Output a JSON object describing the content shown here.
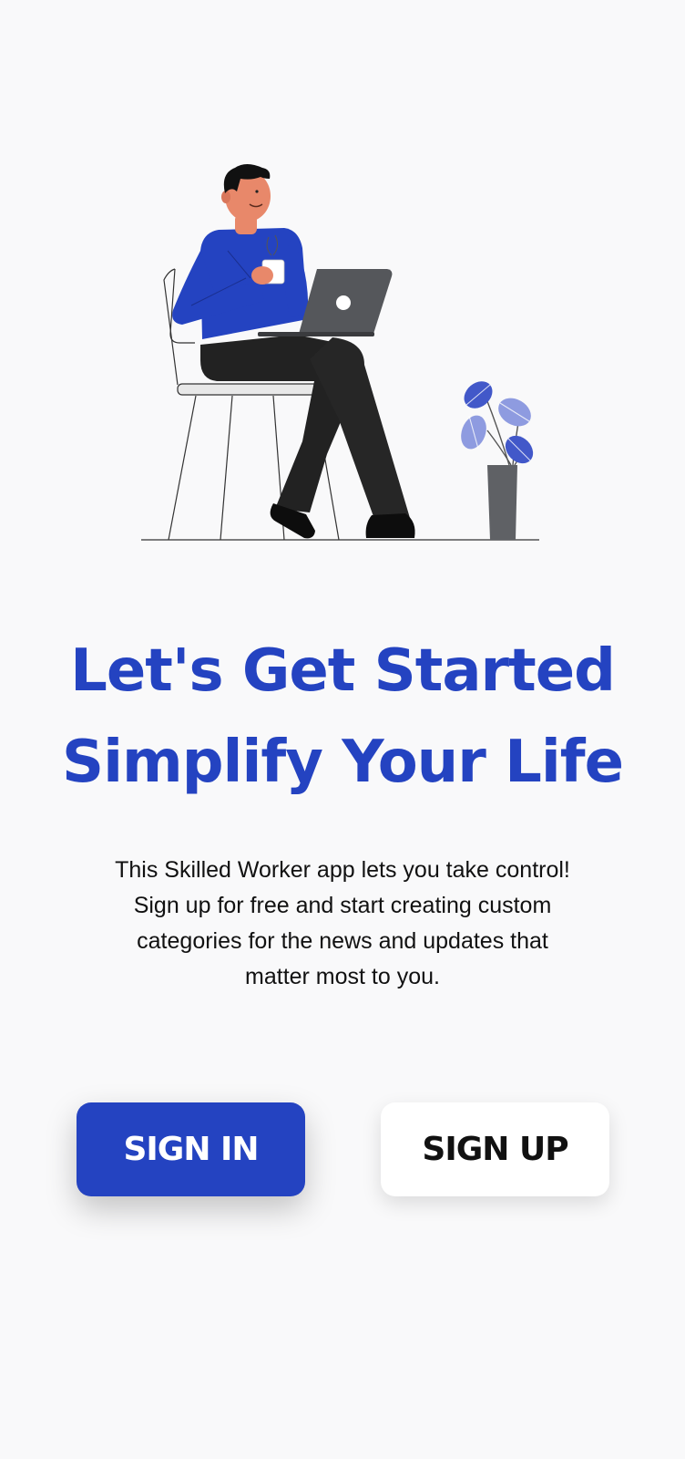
{
  "onboarding": {
    "headline_line1": "Let's Get Started",
    "headline_line2": "Simplify Your Life",
    "description_line1": "This Skilled Worker app lets you take control!",
    "description_line2": "Sign up for free and start creating custom",
    "description_line3": "categories for the news and updates that",
    "description_line4": "matter most to you.",
    "sign_in_label": "SIGN IN",
    "sign_up_label": "SIGN UP"
  },
  "illustration": {
    "subject": "man-working-on-laptop-illustration",
    "icons": [
      "person-icon",
      "chair-icon",
      "laptop-icon",
      "coffee-mug-icon",
      "plant-icon"
    ]
  },
  "colors": {
    "accent": "#2443c1",
    "background": "#f9f9fa",
    "text": "#111111",
    "button_secondary": "#ffffff"
  }
}
